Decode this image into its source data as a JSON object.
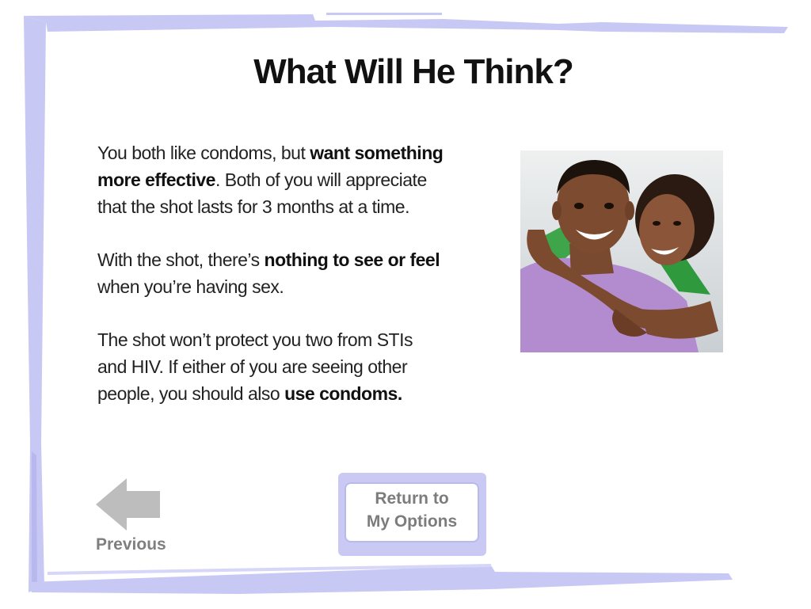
{
  "page": {
    "title": "What Will He Think?"
  },
  "content": {
    "p1_a": "You both like condoms, but ",
    "p1_b": "want something more effective",
    "p1_c": ". Both of you will appreciate that the shot lasts for 3 months at a time.",
    "p2_a": "With the shot, there’s ",
    "p2_b": "nothing to see or feel",
    "p2_c": " when you’re having sex.",
    "p3_a": "The shot won’t protect you two from STIs and HIV. If either of you are seeing other people, you should also ",
    "p3_b": "use condoms."
  },
  "nav": {
    "previous_label": "Previous",
    "return_line1": "Return to",
    "return_line2": "My Options"
  },
  "colors": {
    "frame": "#c8c8f5",
    "button_frame": "#c9c9f4",
    "arrow": "#bdbdbd",
    "nav_text": "#7f7f7f"
  },
  "icons": {
    "previous": "left-arrow-icon",
    "photo": "couple-photo"
  }
}
